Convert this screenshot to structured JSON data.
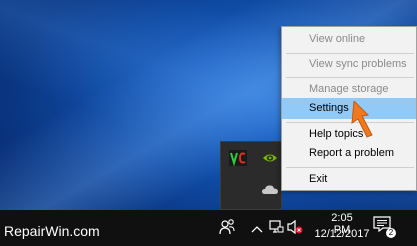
{
  "context_menu": {
    "items": [
      {
        "label": "View online",
        "state": "disabled"
      },
      {
        "label": "View sync problems",
        "state": "disabled"
      },
      {
        "label": "Manage storage",
        "state": "disabled"
      },
      {
        "label": "Settings",
        "state": "highlighted"
      },
      {
        "label": "Help topics",
        "state": "enabled"
      },
      {
        "label": "Report a problem",
        "state": "enabled"
      },
      {
        "label": "Exit",
        "state": "enabled"
      }
    ]
  },
  "tray_flyout": {
    "icons": [
      "app-vc-icon",
      "nvidia-icon",
      "onedrive-cloud-icon"
    ]
  },
  "taskbar": {
    "watermark": "RepairWin.com",
    "tray_icons": [
      "people-icon",
      "chevron-up-icon",
      "network-icon",
      "volume-muted-icon"
    ],
    "clock": {
      "time": "2:05 PM",
      "date": "12/12/2017"
    },
    "notifications": {
      "icon": "action-center-icon",
      "count": "2"
    }
  },
  "colors": {
    "menu_bg": "#f2f2f2",
    "menu_highlight": "#91c9f7",
    "taskbar_bg": "#101010",
    "cursor_accent": "#f0781e"
  }
}
